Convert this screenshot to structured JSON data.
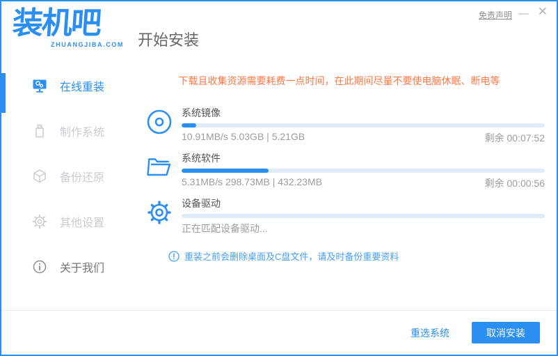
{
  "colors": {
    "accent": "#2a8ff0",
    "warning": "#ff7744",
    "note": "#46a0f5",
    "inactive_sidebar": "#c9ccd1",
    "track": "#e1ecfa"
  },
  "titlebar": {
    "logo_cn": "装机吧",
    "logo_en": "ZHUANGJIBA.COM",
    "page_title": "开始安装",
    "disclaimer": "免责声明",
    "minimize": "—",
    "close": "✕"
  },
  "sidebar": {
    "items": [
      {
        "label": "在线重装",
        "active": true
      },
      {
        "label": "制作系统",
        "active": false
      },
      {
        "label": "备份还原",
        "active": false
      },
      {
        "label": "其他设置",
        "active": false
      },
      {
        "label": "关于我们",
        "active": false
      }
    ]
  },
  "main": {
    "warning": "下载且收集资源需要耗费一点时间，在此期间尽量不要使电脑休眠、断电等",
    "tasks": [
      {
        "name": "系统镜像",
        "detail": "10.91MB/s 5.03GB | 5.21GB",
        "remaining": "剩余 00:07:52",
        "percent": 4
      },
      {
        "name": "系统软件",
        "detail": "5.31MB/s 298.73MB | 432.23MB",
        "remaining": "剩余 00:00:56",
        "percent": 24
      },
      {
        "name": "设备驱动",
        "detail": "正在匹配设备驱动...",
        "remaining": "",
        "percent": 0
      }
    ],
    "note": "重装之前会删除桌面及C盘文件，请及时备份重要资料"
  },
  "footer": {
    "reselect": "重选系统",
    "cancel": "取消安装"
  }
}
